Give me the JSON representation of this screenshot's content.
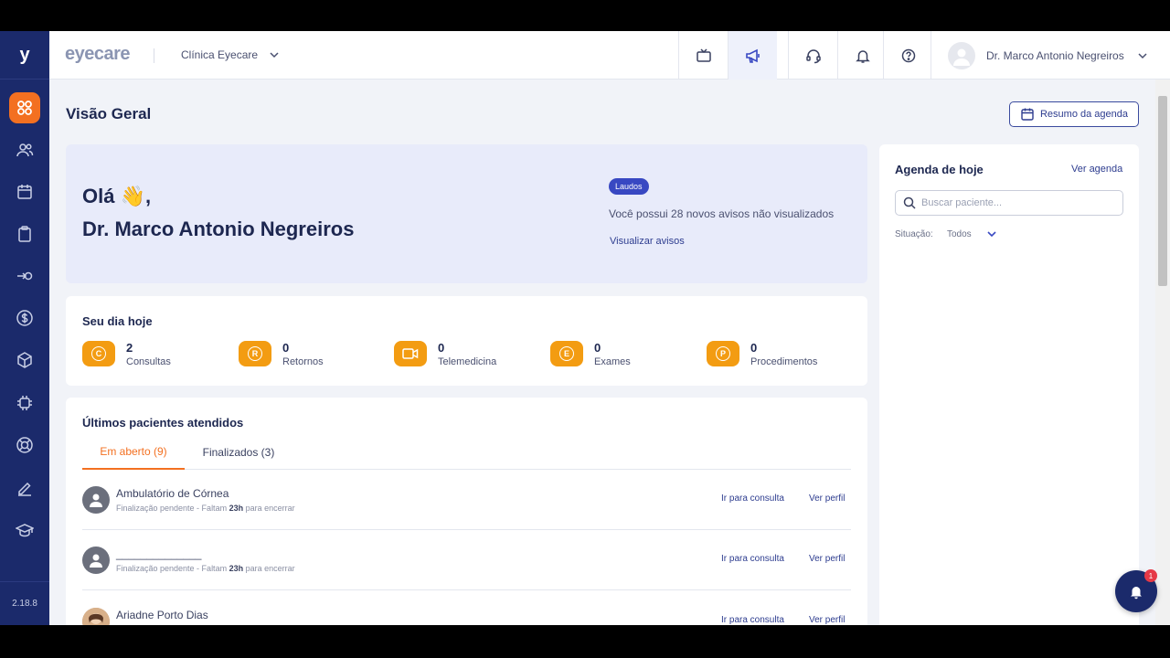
{
  "sidebar": {
    "logo": "y",
    "version": "2.18.8",
    "items": [
      {
        "icon": "dashboard-icon"
      },
      {
        "icon": "users-icon"
      },
      {
        "icon": "calendar-icon"
      },
      {
        "icon": "clipboard-icon"
      },
      {
        "icon": "login-icon"
      },
      {
        "icon": "dollar-icon"
      },
      {
        "icon": "box-icon"
      },
      {
        "icon": "chip-icon"
      },
      {
        "icon": "lifebuoy-icon"
      },
      {
        "icon": "pencil-icon"
      },
      {
        "icon": "graduation-cap-icon"
      }
    ]
  },
  "header": {
    "brand": "eyecare",
    "clinic": "Clínica Eyecare",
    "user_name": "Dr. Marco Antonio Negreiros",
    "icons": [
      "tv-icon",
      "megaphone-icon",
      "headset-icon",
      "bell-icon",
      "help-icon"
    ]
  },
  "page": {
    "title": "Visão Geral",
    "resumo_button": "Resumo da agenda"
  },
  "welcome": {
    "greeting": "Olá",
    "wave": "👋",
    "greeting_suffix": ",",
    "doctor": "Dr. Marco Antonio Negreiros",
    "badge": "Laudos",
    "notice": "Você possui 28 novos avisos não visualizados",
    "view_link": "Visualizar avisos"
  },
  "day": {
    "title": "Seu dia hoje",
    "stats": [
      {
        "letter": "C",
        "value": "2",
        "label": "Consultas"
      },
      {
        "letter": "R",
        "value": "0",
        "label": "Retornos"
      },
      {
        "letter": "",
        "value": "0",
        "label": "Telemedicina"
      },
      {
        "letter": "E",
        "value": "0",
        "label": "Exames"
      },
      {
        "letter": "P",
        "value": "0",
        "label": "Procedimentos"
      }
    ]
  },
  "patients": {
    "title": "Últimos pacientes atendidos",
    "tab_open": "Em aberto (9)",
    "tab_done": "Finalizados (3)",
    "rows": [
      {
        "name": "Ambulatório de Córnea",
        "status_prefix": "Finalização pendente - Faltam ",
        "status_hours": "23h",
        "status_suffix": " para encerrar",
        "action1": "Ir para consulta",
        "action2": "Ver perfil"
      },
      {
        "name": "______________",
        "status_prefix": "Finalização pendente - Faltam ",
        "status_hours": "23h",
        "status_suffix": " para encerrar",
        "action1": "Ir para consulta",
        "action2": "Ver perfil"
      },
      {
        "name": "Ariadne Porto Dias",
        "status_prefix": "",
        "status_hours": "",
        "status_suffix": "",
        "action1": "Ir para consulta",
        "action2": "Ver perfil"
      }
    ]
  },
  "agenda": {
    "title": "Agenda de hoje",
    "ver_agenda": "Ver agenda",
    "search_placeholder": "Buscar paciente...",
    "situacao_label": "Situação:",
    "situacao_value": "Todos"
  },
  "notifications": {
    "count": "1"
  },
  "colors": {
    "sidebar": "#1b2a6b",
    "accent_orange": "#f37021",
    "stat_orange": "#f39c12",
    "link_blue": "#2d3c8f",
    "welcome_bg": "#e8ebfa"
  }
}
